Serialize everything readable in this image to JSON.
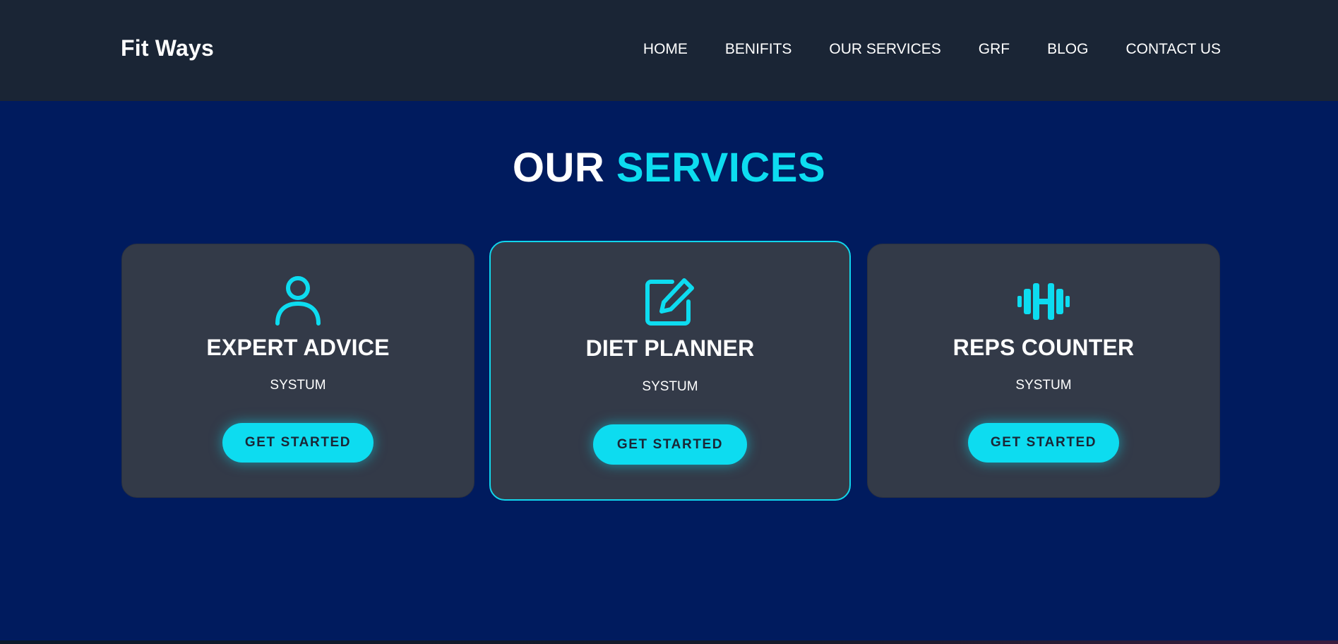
{
  "header": {
    "brand": "Fit Ways",
    "nav": [
      "HOME",
      "BENIFITS",
      "OUR SERVICES",
      "GRF",
      "BLOG",
      "CONTACT US"
    ]
  },
  "services": {
    "title_white": "OUR",
    "title_cyan": "SERVICES",
    "cards": [
      {
        "icon": "user-icon",
        "title": "EXPERT ADVICE",
        "subtitle": "SYSTUM",
        "button": "GET STARTED"
      },
      {
        "icon": "edit-icon",
        "title": "DIET PLANNER",
        "subtitle": "SYSTUM",
        "button": "GET STARTED"
      },
      {
        "icon": "dumbbell-icon",
        "title": "REPS COUNTER",
        "subtitle": "SYSTUM",
        "button": "GET STARTED"
      }
    ]
  },
  "colors": {
    "accent": "#0ddcf0",
    "background": "#001b5e",
    "navbar": "#1a2535",
    "card": "#333a48"
  }
}
